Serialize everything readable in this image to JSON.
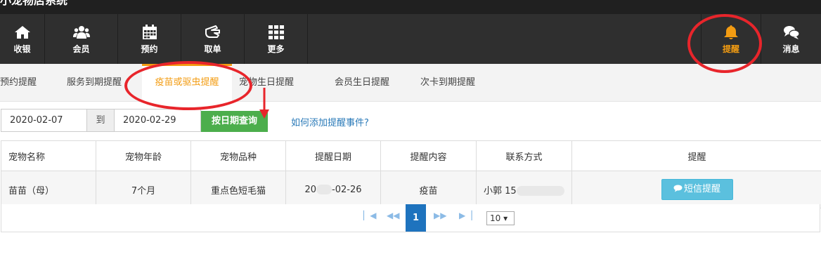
{
  "app": {
    "title": "小宠物店系统"
  },
  "nav": {
    "items": [
      {
        "label": "收银",
        "icon": "home-icon"
      },
      {
        "label": "会员",
        "icon": "users-icon"
      },
      {
        "label": "预约",
        "icon": "calendar-icon"
      },
      {
        "label": "取单",
        "icon": "hand-icon"
      },
      {
        "label": "更多",
        "icon": "grid-icon"
      }
    ],
    "right": [
      {
        "label": "提醒",
        "icon": "bell-icon",
        "color": "#f39c12"
      },
      {
        "label": "消息",
        "icon": "chat-icon"
      }
    ]
  },
  "subtabs": [
    "预约提醒",
    "服务到期提醒",
    "疫苗或驱虫提醒",
    "宠物生日提醒",
    "会员生日提醒",
    "次卡到期提醒"
  ],
  "filter": {
    "start_date": "2020-02-07",
    "to_label": "到",
    "end_date": "2020-02-29",
    "query_button": "按日期查询",
    "help_link": "如何添加提醒事件?"
  },
  "table": {
    "headers": [
      "宠物名称",
      "宠物年龄",
      "宠物品种",
      "提醒日期",
      "提醒内容",
      "联系方式",
      "提醒"
    ],
    "rows": [
      {
        "name": "苗苗（母）",
        "age": "7个月",
        "breed": "重点色短毛猫",
        "date_prefix": "20",
        "date_suffix": "-02-26",
        "content": "疫苗",
        "contact": "小郭 15",
        "action": "短信提醒"
      }
    ]
  },
  "pagination": {
    "current": "1",
    "page_size": "10 ▾"
  },
  "colors": {
    "accent": "#f39c12",
    "primary": "#1e73be",
    "success": "#4cae4c",
    "info": "#5bc0de",
    "annotation": "#e8252b"
  }
}
